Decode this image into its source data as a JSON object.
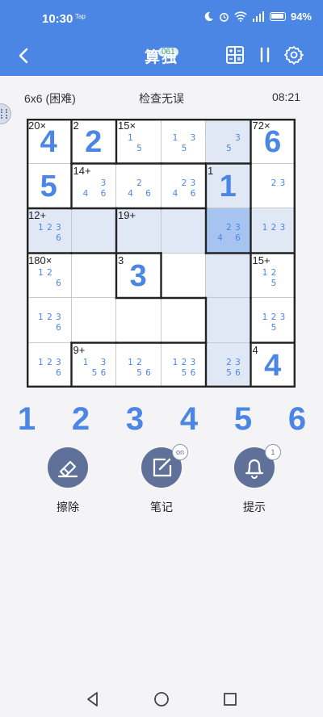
{
  "status": {
    "time": "10:30",
    "tap": "Tap",
    "battery": "94%",
    "network": "4G"
  },
  "header": {
    "title": "算独",
    "badge": "061"
  },
  "info": {
    "difficulty": "6x6 (困难)",
    "check": "检查无误",
    "timer": "08:21"
  },
  "colors": {
    "accent": "#4b86e4",
    "selected": "#a7c4f1",
    "related": "#e1e8f5",
    "tool": "#5f7199"
  },
  "board": {
    "size": 6,
    "selected": [
      2,
      4
    ],
    "cages": [
      {
        "label": "20×",
        "cells": [
          [
            0,
            0
          ],
          [
            1,
            0
          ]
        ]
      },
      {
        "label": "2",
        "cells": [
          [
            0,
            1
          ]
        ]
      },
      {
        "label": "15×",
        "cells": [
          [
            0,
            2
          ],
          [
            0,
            3
          ],
          [
            0,
            4
          ]
        ]
      },
      {
        "label": "72×",
        "cells": [
          [
            0,
            5
          ],
          [
            1,
            5
          ],
          [
            2,
            5
          ]
        ]
      },
      {
        "label": "14+",
        "cells": [
          [
            1,
            1
          ],
          [
            1,
            2
          ],
          [
            1,
            3
          ]
        ]
      },
      {
        "label": "1",
        "cells": [
          [
            1,
            4
          ],
          [
            2,
            4
          ]
        ]
      },
      {
        "label": "12+",
        "cells": [
          [
            2,
            0
          ],
          [
            2,
            1
          ]
        ]
      },
      {
        "label": "19+",
        "cells": [
          [
            2,
            2
          ],
          [
            2,
            3
          ],
          [
            3,
            3
          ],
          [
            3,
            4
          ],
          [
            4,
            4
          ],
          [
            5,
            4
          ]
        ]
      },
      {
        "label": "180×",
        "cells": [
          [
            3,
            0
          ],
          [
            3,
            1
          ],
          [
            4,
            0
          ],
          [
            5,
            0
          ],
          [
            4,
            1
          ],
          [
            4,
            2
          ],
          [
            4,
            3
          ]
        ]
      },
      {
        "label": "3",
        "cells": [
          [
            3,
            2
          ]
        ]
      },
      {
        "label": "15+",
        "cells": [
          [
            3,
            5
          ],
          [
            4,
            5
          ]
        ]
      },
      {
        "label": "9+",
        "cells": [
          [
            5,
            1
          ],
          [
            5,
            2
          ],
          [
            5,
            3
          ]
        ]
      },
      {
        "label": "4",
        "cells": [
          [
            5,
            5
          ]
        ]
      }
    ],
    "cells": [
      [
        {
          "value": "4"
        },
        {
          "value": "2"
        },
        {
          "notes": [
            1,
            5
          ]
        },
        {
          "notes": [
            1,
            3,
            5
          ]
        },
        {
          "notes": [
            3,
            5
          ]
        },
        {
          "value": "6"
        }
      ],
      [
        {
          "value": "5"
        },
        {
          "notes": [
            3,
            4,
            6
          ]
        },
        {
          "notes": [
            2,
            4,
            6
          ]
        },
        {
          "notes": [
            2,
            3,
            4,
            6
          ]
        },
        {
          "value": "1"
        },
        {
          "notes": [
            2,
            3
          ]
        }
      ],
      [
        {
          "notes": [
            1,
            2,
            3,
            6
          ]
        },
        {
          "notes": []
        },
        {
          "notes": []
        },
        {
          "notes": []
        },
        {
          "notes": [
            2,
            3,
            4,
            6
          ]
        },
        {
          "notes": [
            1,
            2,
            3
          ]
        }
      ],
      [
        {
          "notes": [
            1,
            2,
            6
          ]
        },
        {
          "notes": []
        },
        {
          "value": "3"
        },
        {
          "notes": []
        },
        {
          "notes": []
        },
        {
          "notes": [
            1,
            2,
            5
          ]
        }
      ],
      [
        {
          "notes": [
            1,
            2,
            3,
            6
          ]
        },
        {
          "notes": []
        },
        {
          "notes": []
        },
        {
          "notes": []
        },
        {
          "notes": []
        },
        {
          "notes": [
            1,
            2,
            3,
            5
          ]
        }
      ],
      [
        {
          "notes": [
            1,
            2,
            3,
            6
          ]
        },
        {
          "notes": [
            1,
            3,
            5,
            6
          ]
        },
        {
          "notes": [
            1,
            2,
            5,
            6
          ]
        },
        {
          "notes": [
            1,
            2,
            3,
            5,
            6
          ]
        },
        {
          "notes": [
            2,
            3,
            5,
            6
          ]
        },
        {
          "value": "4"
        }
      ]
    ]
  },
  "numbers": [
    "1",
    "2",
    "3",
    "4",
    "5",
    "6"
  ],
  "tools": [
    {
      "id": "erase",
      "label": "擦除",
      "icon": "eraser-icon",
      "badge": ""
    },
    {
      "id": "notes",
      "label": "笔记",
      "icon": "pencil-icon",
      "badge": "on"
    },
    {
      "id": "hint",
      "label": "提示",
      "icon": "bell-icon",
      "badge": "1"
    }
  ]
}
